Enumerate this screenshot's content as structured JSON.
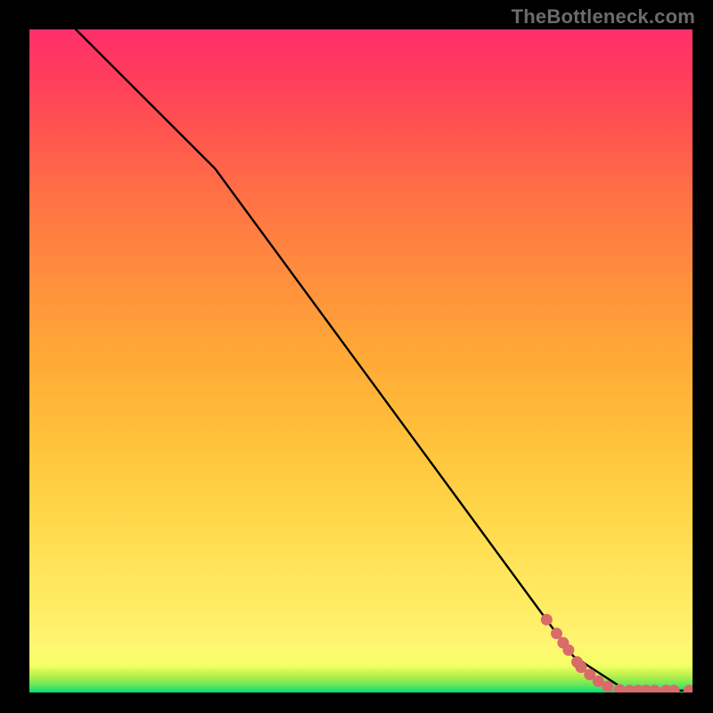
{
  "watermark": "TheBottleneck.com",
  "colors": {
    "marker": "#d96b6b",
    "curve": "#000000",
    "frame": "#000000"
  },
  "chart_data": {
    "type": "line",
    "title": "",
    "xlabel": "",
    "ylabel": "",
    "xlim": [
      0,
      100
    ],
    "ylim": [
      0,
      100
    ],
    "grid": false,
    "legend": false,
    "series": [
      {
        "name": "bottleneck-curve",
        "x": [
          7,
          28,
          82,
          90,
          100
        ],
        "y": [
          100,
          79,
          5.5,
          0.3,
          0.3
        ]
      }
    ],
    "markers": {
      "name": "highlighted-points",
      "points": [
        {
          "x": 78.0,
          "y": 11.0
        },
        {
          "x": 79.5,
          "y": 8.9
        },
        {
          "x": 80.5,
          "y": 7.5
        },
        {
          "x": 81.3,
          "y": 6.4
        },
        {
          "x": 82.6,
          "y": 4.6
        },
        {
          "x": 83.2,
          "y": 3.8
        },
        {
          "x": 84.5,
          "y": 2.7
        },
        {
          "x": 85.8,
          "y": 1.7
        },
        {
          "x": 87.2,
          "y": 0.9
        },
        {
          "x": 89.0,
          "y": 0.4
        },
        {
          "x": 90.5,
          "y": 0.3
        },
        {
          "x": 91.8,
          "y": 0.3
        },
        {
          "x": 93.0,
          "y": 0.3
        },
        {
          "x": 94.3,
          "y": 0.3
        },
        {
          "x": 96.0,
          "y": 0.3
        },
        {
          "x": 97.2,
          "y": 0.3
        },
        {
          "x": 99.5,
          "y": 0.3
        }
      ]
    }
  }
}
